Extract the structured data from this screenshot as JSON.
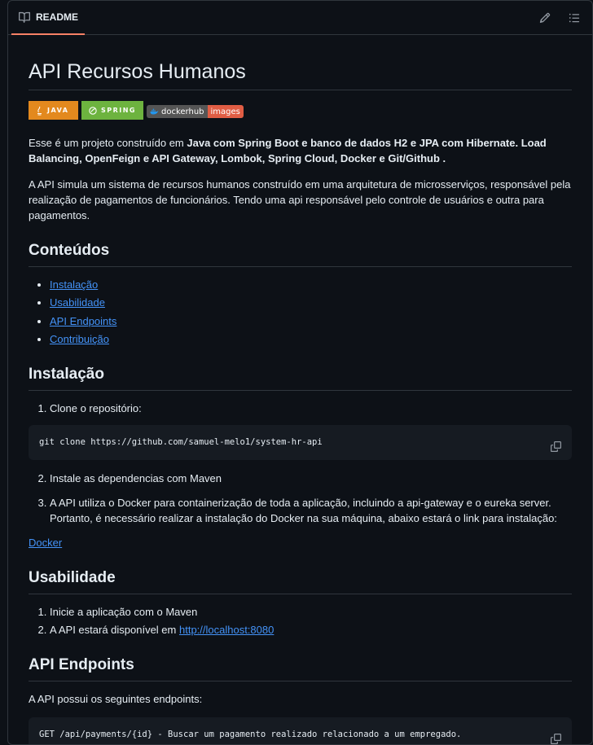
{
  "tab": {
    "label": "README"
  },
  "actions": {
    "edit_icon": "pencil-icon",
    "toc_icon": "list-icon"
  },
  "badges": {
    "java": "JAVA",
    "spring": "SPRING",
    "docker_left": "dockerhub",
    "docker_right": "images"
  },
  "title": "API Recursos Humanos",
  "intro": {
    "part1": "Esse é um projeto construído em ",
    "bold": "Java com Spring Boot e banco de dados H2 e JPA com Hibernate. Load Balancing, OpenFeign e API Gateway, Lombok, Spring Cloud, Docker e Git/Github",
    "part2": " ."
  },
  "description": "A API simula um sistema de recursos humanos construído em uma arquitetura de microsserviços, responsável pela realização de pagamentos de funcionários. Tendo uma api responsável pelo controle de usuários e outra para pagamentos.",
  "contents": {
    "heading": "Conteúdos",
    "items": [
      "Instalação",
      "Usabilidade",
      "API Endpoints",
      "Contribuição"
    ]
  },
  "install": {
    "heading": "Instalação",
    "step1": "Clone o repositório:",
    "code": "git clone https://github.com/samuel-melo1/system-hr-api",
    "step2": "Instale as dependencias com Maven",
    "step3": "A API utiliza o Docker para containerização de toda a aplicação, incluindo a api-gateway e o eureka server. Portanto, é necessário realizar a instalação do Docker na sua máquina, abaixo estará o link para instalação:",
    "docker_link": "Docker"
  },
  "usage": {
    "heading": "Usabilidade",
    "step1": "Inicie a aplicação com o Maven",
    "step2_text": "A API estará disponível em ",
    "step2_link": "http://localhost:8080"
  },
  "endpoints": {
    "heading": "API Endpoints",
    "intro": "A API possui os seguintes endpoints:",
    "code": "GET /api/payments/{id} - Buscar um pagamento realizado relacionado a um empregado."
  },
  "colors": {
    "accent": "#4493f8",
    "tab_underline": "#f78166",
    "background": "#0d1117",
    "border": "#30363d"
  }
}
